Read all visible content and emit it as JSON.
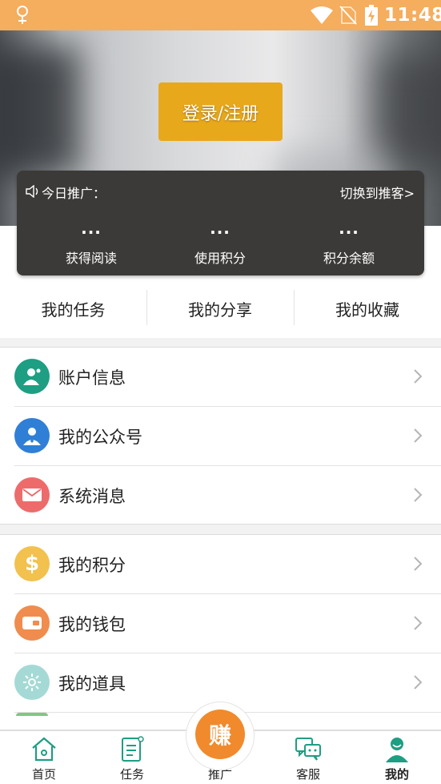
{
  "status_bar": {
    "time": "11:48",
    "bg_color": "#f5ad5e"
  },
  "hero": {
    "login_button": "登录/注册",
    "login_button_color": "#e8a81c"
  },
  "promo_card": {
    "today_label": "今日推广：",
    "switch_link": "切换到推客>",
    "stats": [
      {
        "value": "...",
        "label": "获得阅读"
      },
      {
        "value": "...",
        "label": "使用积分"
      },
      {
        "value": "...",
        "label": "积分余额"
      }
    ]
  },
  "tabs": [
    {
      "label": "我的任务"
    },
    {
      "label": "我的分享"
    },
    {
      "label": "我的收藏"
    }
  ],
  "menu_group_1": [
    {
      "label": "账户信息",
      "icon": "user-icon",
      "color": "#1e9e82"
    },
    {
      "label": "我的公众号",
      "icon": "official-account-icon",
      "color": "#2f7fd6"
    },
    {
      "label": "系统消息",
      "icon": "mail-icon",
      "color": "#ee6b6b"
    }
  ],
  "menu_group_2": [
    {
      "label": "我的积分",
      "icon": "dollar-icon",
      "color": "#f2c14e"
    },
    {
      "label": "我的钱包",
      "icon": "wallet-icon",
      "color": "#f08c4e"
    },
    {
      "label": "我的道具",
      "icon": "sun-icon",
      "color": "#a5d9d6"
    }
  ],
  "bottom_nav": [
    {
      "label": "首页",
      "icon": "home-icon"
    },
    {
      "label": "任务",
      "icon": "task-icon"
    },
    {
      "label": "推广",
      "icon": "earn-icon",
      "badge": "赚"
    },
    {
      "label": "客服",
      "icon": "chat-icon"
    },
    {
      "label": "我的",
      "icon": "profile-icon",
      "active": true
    }
  ],
  "accent_color": "#f08a2c"
}
